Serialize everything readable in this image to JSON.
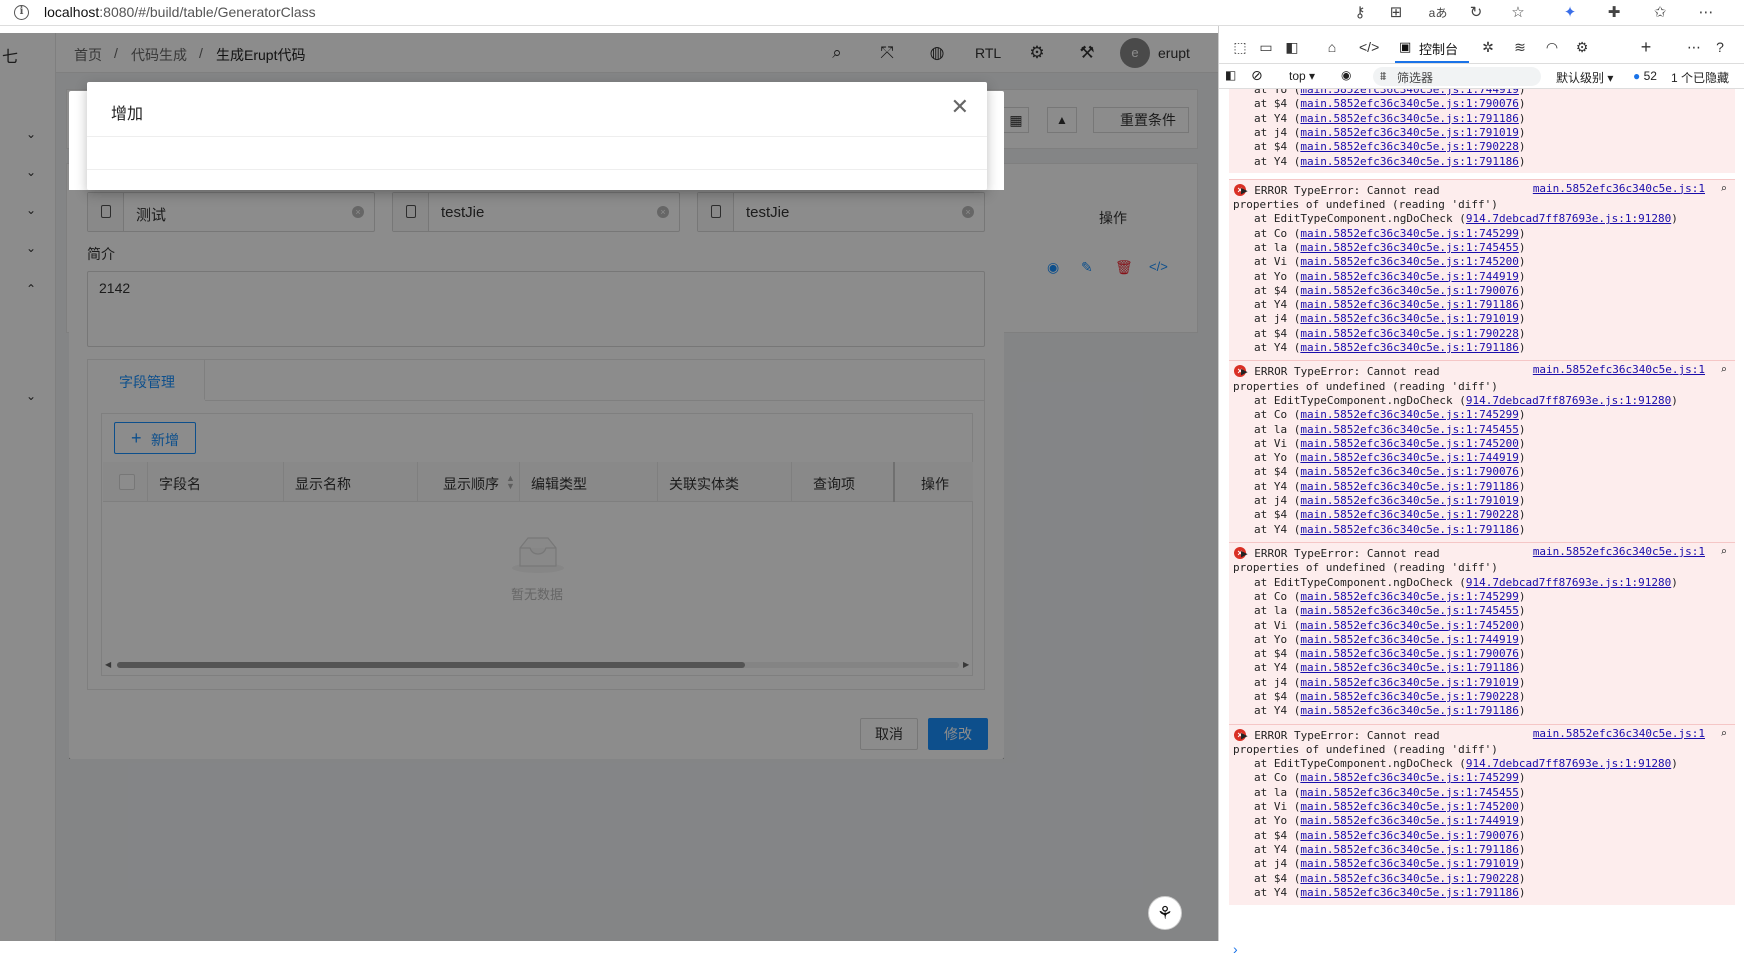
{
  "browser": {
    "url_host": "localhost",
    "url_rest": ":8080/#/build/table/GeneratorClass"
  },
  "header": {
    "breadcrumbs": [
      "首页",
      "/",
      "代码生成",
      "/",
      "生成Erupt代码"
    ],
    "rtl_label": "RTL",
    "user": "erupt",
    "avatar_letter": "e"
  },
  "sidebar": {
    "brand_char": "七"
  },
  "background": {
    "reset_label": "重置条件",
    "op_header": "操作"
  },
  "modal": {
    "title": "增加",
    "inputs": [
      "测试",
      "testJie",
      "testJie"
    ],
    "desc_label": "简介",
    "desc_value": "2142",
    "tab_label": "字段管理",
    "add_button": "新增",
    "columns": [
      "字段名",
      "显示名称",
      "显示顺序",
      "编辑类型",
      "关联实体类",
      "查询项",
      "操作"
    ],
    "empty_text": "暂无数据",
    "cancel": "取消",
    "submit": "修改"
  },
  "devtools": {
    "console_tab": "控制台",
    "context": "top",
    "filter_placeholder": "筛选器",
    "level": "默认级别",
    "issues_count": "52",
    "hidden": "1 个已隐藏",
    "stack_head": [
      "at Yo (main.5852efc36c340c5e.js:1:744919)",
      "at $4 (main.5852efc36c340c5e.js:1:790076)",
      "at Y4 (main.5852efc36c340c5e.js:1:791186)",
      "at j4 (main.5852efc36c340c5e.js:1:791019)",
      "at $4 (main.5852efc36c340c5e.js:1:790228)",
      "at Y4 (main.5852efc36c340c5e.js:1:791186)"
    ],
    "error_line1": "ERROR TypeError: Cannot read",
    "error_line2": "properties of undefined (reading 'diff')",
    "error_source": "main.5852efc36c340c5e.js:1",
    "stack": [
      "at EditTypeComponent.ngDoCheck (914.7debcad7ff87693e.js:1:91280)",
      "at Co (main.5852efc36c340c5e.js:1:745299)",
      "at la (main.5852efc36c340c5e.js:1:745455)",
      "at Vi (main.5852efc36c340c5e.js:1:745200)",
      "at Yo (main.5852efc36c340c5e.js:1:744919)",
      "at $4 (main.5852efc36c340c5e.js:1:790076)",
      "at Y4 (main.5852efc36c340c5e.js:1:791186)",
      "at j4 (main.5852efc36c340c5e.js:1:791019)",
      "at $4 (main.5852efc36c340c5e.js:1:790228)",
      "at Y4 (main.5852efc36c340c5e.js:1:791186)"
    ]
  }
}
